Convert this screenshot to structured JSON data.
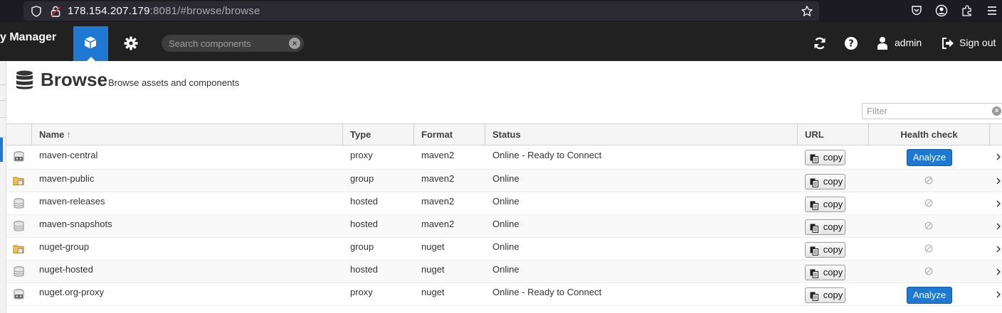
{
  "browser": {
    "url_host": "178.154.207.179",
    "url_rest": ":8081/#browse/browse"
  },
  "header": {
    "brand": "y Manager",
    "search_placeholder": "Search components",
    "user_label": "admin",
    "signout_label": "Sign out",
    "accent": "#1f78d1"
  },
  "page": {
    "title": "Browse",
    "subtitle": "Browse assets and components",
    "filter_placeholder": "Filter"
  },
  "grid": {
    "columns": {
      "name": "Name",
      "type": "Type",
      "format": "Format",
      "status": "Status",
      "url": "URL",
      "health": "Health check"
    },
    "sort_indicator": "↑",
    "copy_label": "copy",
    "analyze_label": "Analyze",
    "rows": [
      {
        "name": "maven-central",
        "type": "proxy",
        "format": "maven2",
        "status": "Online - Ready to Connect",
        "icon": "proxy-repo-icon",
        "health": "analyze"
      },
      {
        "name": "maven-public",
        "type": "group",
        "format": "maven2",
        "status": "Online",
        "icon": "group-repo-icon",
        "health": "na"
      },
      {
        "name": "maven-releases",
        "type": "hosted",
        "format": "maven2",
        "status": "Online",
        "icon": "hosted-repo-icon",
        "health": "na"
      },
      {
        "name": "maven-snapshots",
        "type": "hosted",
        "format": "maven2",
        "status": "Online",
        "icon": "hosted-repo-icon",
        "health": "na"
      },
      {
        "name": "nuget-group",
        "type": "group",
        "format": "nuget",
        "status": "Online",
        "icon": "group-repo-icon",
        "health": "na"
      },
      {
        "name": "nuget-hosted",
        "type": "hosted",
        "format": "nuget",
        "status": "Online",
        "icon": "hosted-repo-icon",
        "health": "na"
      },
      {
        "name": "nuget.org-proxy",
        "type": "proxy",
        "format": "nuget",
        "status": "Online - Ready to Connect",
        "icon": "proxy-repo-icon",
        "health": "analyze"
      }
    ]
  }
}
